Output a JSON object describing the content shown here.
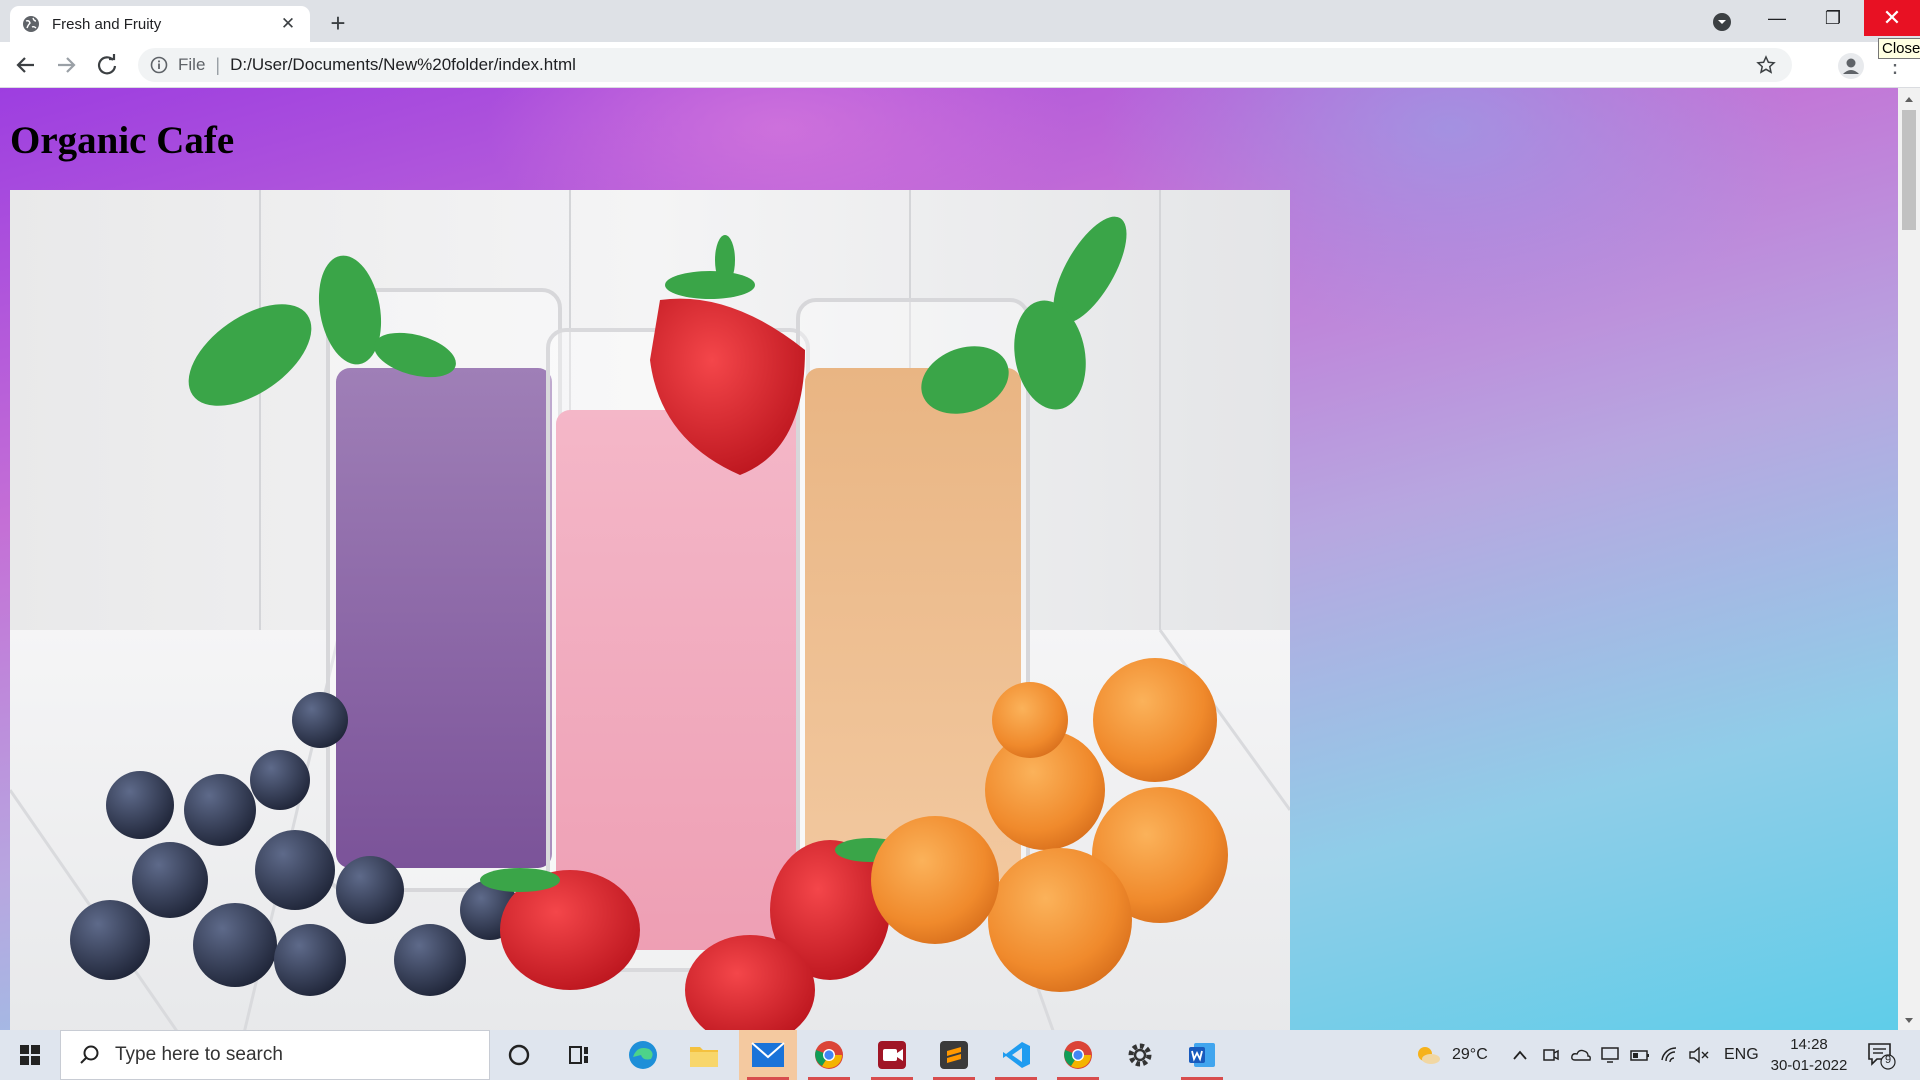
{
  "browser": {
    "tab": {
      "title": "Fresh and Fruity"
    },
    "new_tab_label": "+",
    "window_controls": {
      "close_tooltip": "Close"
    },
    "omnibox": {
      "scheme": "File",
      "url": "D:/User/Documents/New%20folder/index.html"
    }
  },
  "page": {
    "heading": "Organic Cafe",
    "hero_image": "smoothies-with-fruit-photo"
  },
  "taskbar": {
    "search_placeholder": "Type here to search",
    "apps": [
      "cortana-icon",
      "task-view-icon",
      "edge-icon",
      "file-explorer-icon",
      "mail-icon",
      "chrome-icon",
      "screen-recorder-icon",
      "sublime-text-icon",
      "vscode-icon",
      "chrome-icon",
      "settings-icon",
      "word-icon"
    ],
    "weather": "29°C",
    "language": "ENG",
    "time": "14:28",
    "date": "30-01-2022",
    "notification_count": "9"
  }
}
